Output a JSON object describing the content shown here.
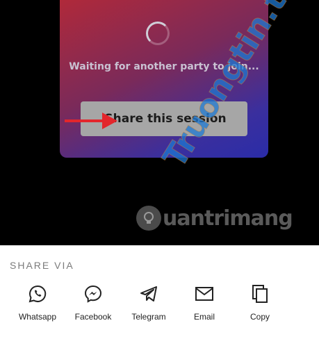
{
  "session": {
    "waiting_text": "Waiting for another party to join...",
    "share_button_label": "Share this session"
  },
  "watermarks": {
    "top_text": "Truongtin.top",
    "bottom_text": "uantrimang"
  },
  "share_sheet": {
    "title": "SHARE VIA",
    "options": [
      {
        "label": "Whatsapp",
        "icon": "whatsapp-icon"
      },
      {
        "label": "Facebook",
        "icon": "messenger-icon"
      },
      {
        "label": "Telegram",
        "icon": "telegram-icon"
      },
      {
        "label": "Email",
        "icon": "email-icon"
      },
      {
        "label": "Copy",
        "icon": "copy-icon"
      }
    ]
  },
  "colors": {
    "card_gradient_start": "#b0293a",
    "card_gradient_end": "#2a2ca8",
    "share_button_bg": "#a6a6a6",
    "arrow": "#e3262c",
    "watermark_blue": "#1e78d2",
    "watermark_orange": "#f08a1c"
  }
}
